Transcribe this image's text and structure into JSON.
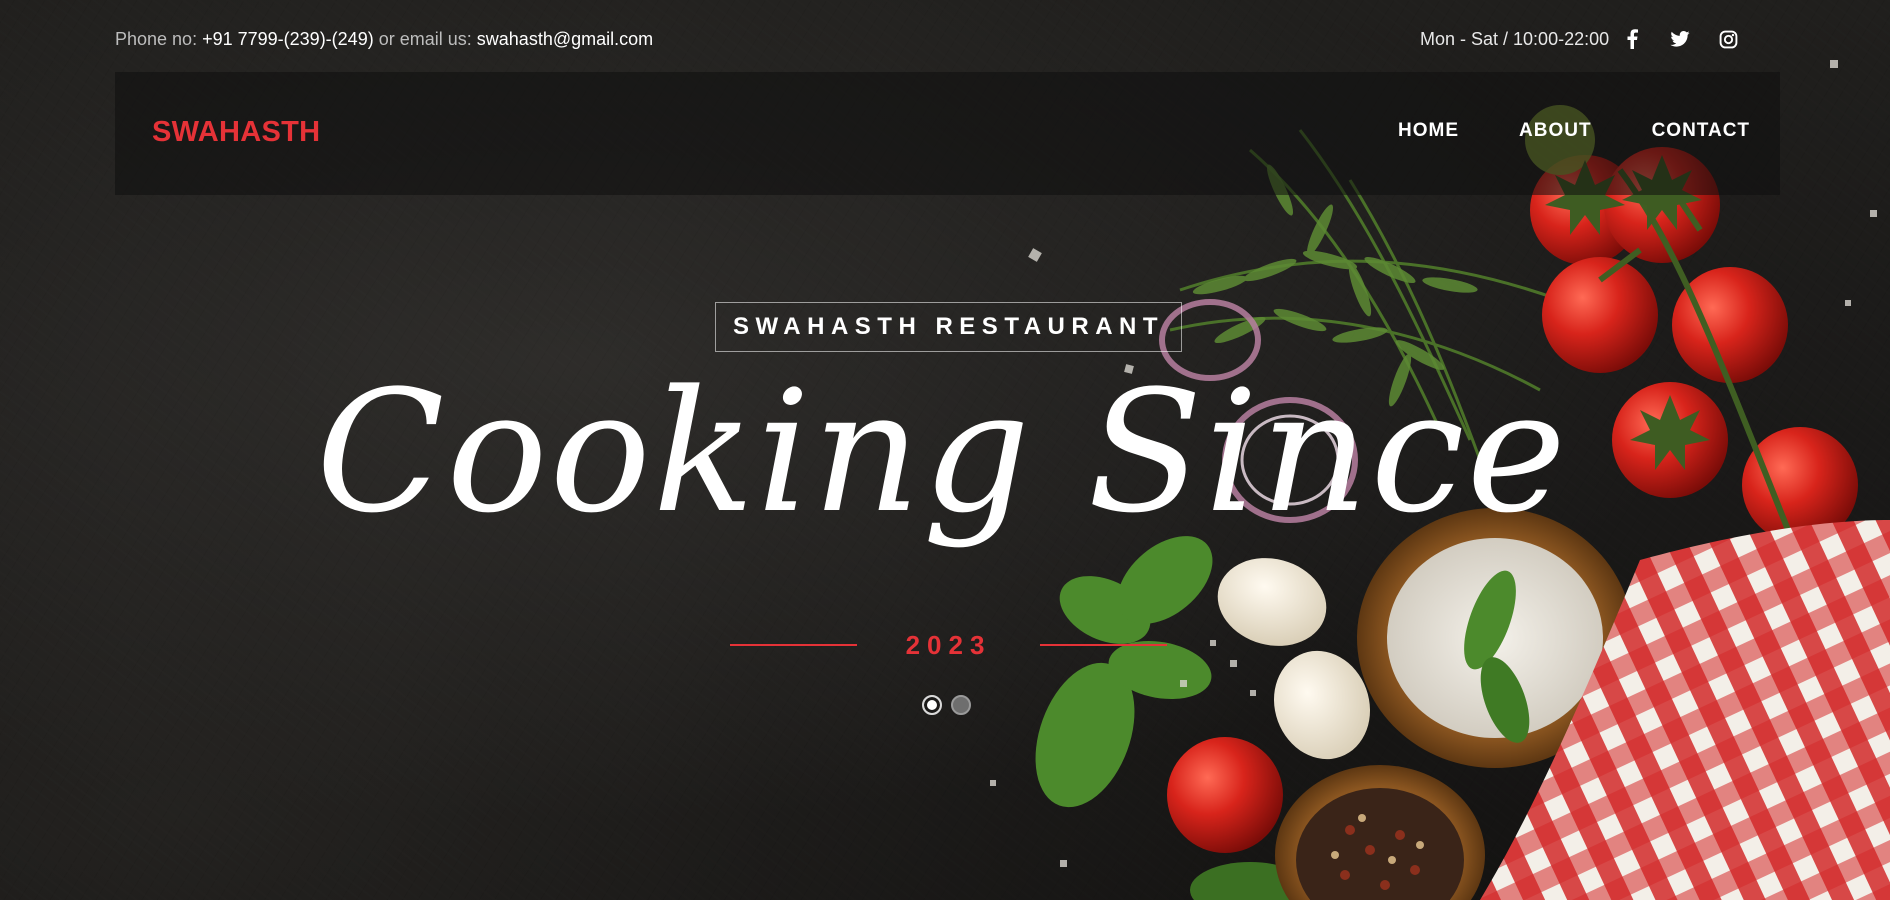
{
  "topbar": {
    "phone_label": "Phone no:",
    "phone_value": "+91 7799-(239)-(249)",
    "or_email_label": "or email us:",
    "email_value": "swahasth@gmail.com",
    "hours": "Mon - Sat / 10:00-22:00",
    "social": [
      {
        "icon": "facebook-icon"
      },
      {
        "icon": "twitter-icon"
      },
      {
        "icon": "instagram-icon"
      }
    ]
  },
  "nav": {
    "brand": "SWAHASTH",
    "links": [
      "HOME",
      "ABOUT",
      "CONTACT"
    ]
  },
  "hero": {
    "eyebrow": "SWAHASTH RESTAURANT",
    "headline": "Cooking Since",
    "year": "2023",
    "slides": {
      "count": 2,
      "active": 1
    }
  },
  "colors": {
    "accent": "#e53237",
    "background": "#1a1918",
    "text": "#ffffff"
  }
}
